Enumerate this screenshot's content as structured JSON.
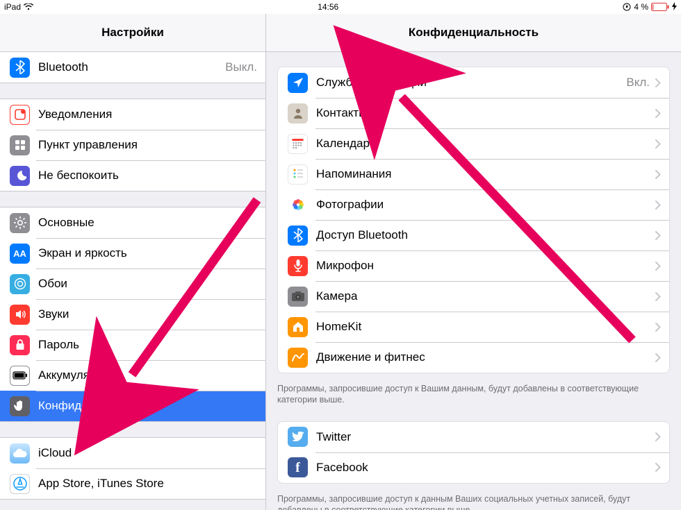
{
  "status": {
    "device": "iPad",
    "time": "14:56",
    "battery_text": "4 %"
  },
  "sidebar": {
    "title": "Настройки",
    "groups": [
      {
        "items": [
          {
            "id": "bluetooth",
            "label": "Bluetooth",
            "value": "Выкл."
          }
        ],
        "flush_top": true
      },
      {
        "items": [
          {
            "id": "notifications",
            "label": "Уведомления"
          },
          {
            "id": "control-center",
            "label": "Пункт управления"
          },
          {
            "id": "dnd",
            "label": "Не беспокоить"
          }
        ]
      },
      {
        "items": [
          {
            "id": "general",
            "label": "Основные"
          },
          {
            "id": "display",
            "label": "Экран и яркость"
          },
          {
            "id": "wallpaper",
            "label": "Обои"
          },
          {
            "id": "sounds",
            "label": "Звуки"
          },
          {
            "id": "passcode",
            "label": "Пароль"
          },
          {
            "id": "battery",
            "label": "Аккумулятор"
          },
          {
            "id": "privacy",
            "label": "Конфиденциальность",
            "selected": true
          }
        ]
      },
      {
        "items": [
          {
            "id": "icloud",
            "label": "iCloud"
          },
          {
            "id": "appstore",
            "label": "App Store, iTunes Store"
          }
        ]
      }
    ]
  },
  "detail": {
    "title": "Конфиденциальность",
    "groups": [
      {
        "items": [
          {
            "id": "location",
            "label": "Службы геолокации",
            "value": "Вкл."
          },
          {
            "id": "contacts",
            "label": "Контакты"
          },
          {
            "id": "calendars",
            "label": "Календари"
          },
          {
            "id": "reminders",
            "label": "Напоминания"
          },
          {
            "id": "photos",
            "label": "Фотографии"
          },
          {
            "id": "bt-sharing",
            "label": "Доступ Bluetooth"
          },
          {
            "id": "microphone",
            "label": "Микрофон"
          },
          {
            "id": "camera",
            "label": "Камера"
          },
          {
            "id": "homekit",
            "label": "HomeKit"
          },
          {
            "id": "motion",
            "label": "Движение и фитнес"
          }
        ],
        "footer": "Программы, запросившие доступ к Вашим данным, будут добавлены в соответствующие категории выше."
      },
      {
        "items": [
          {
            "id": "twitter",
            "label": "Twitter"
          },
          {
            "id": "facebook",
            "label": "Facebook"
          }
        ],
        "footer": "Программы, запросившие доступ к данным Ваших социальных учетных записей, будут добавлены в соответствующие категории выше."
      }
    ]
  },
  "annotations": {
    "arrows_color": "#e6005c"
  }
}
